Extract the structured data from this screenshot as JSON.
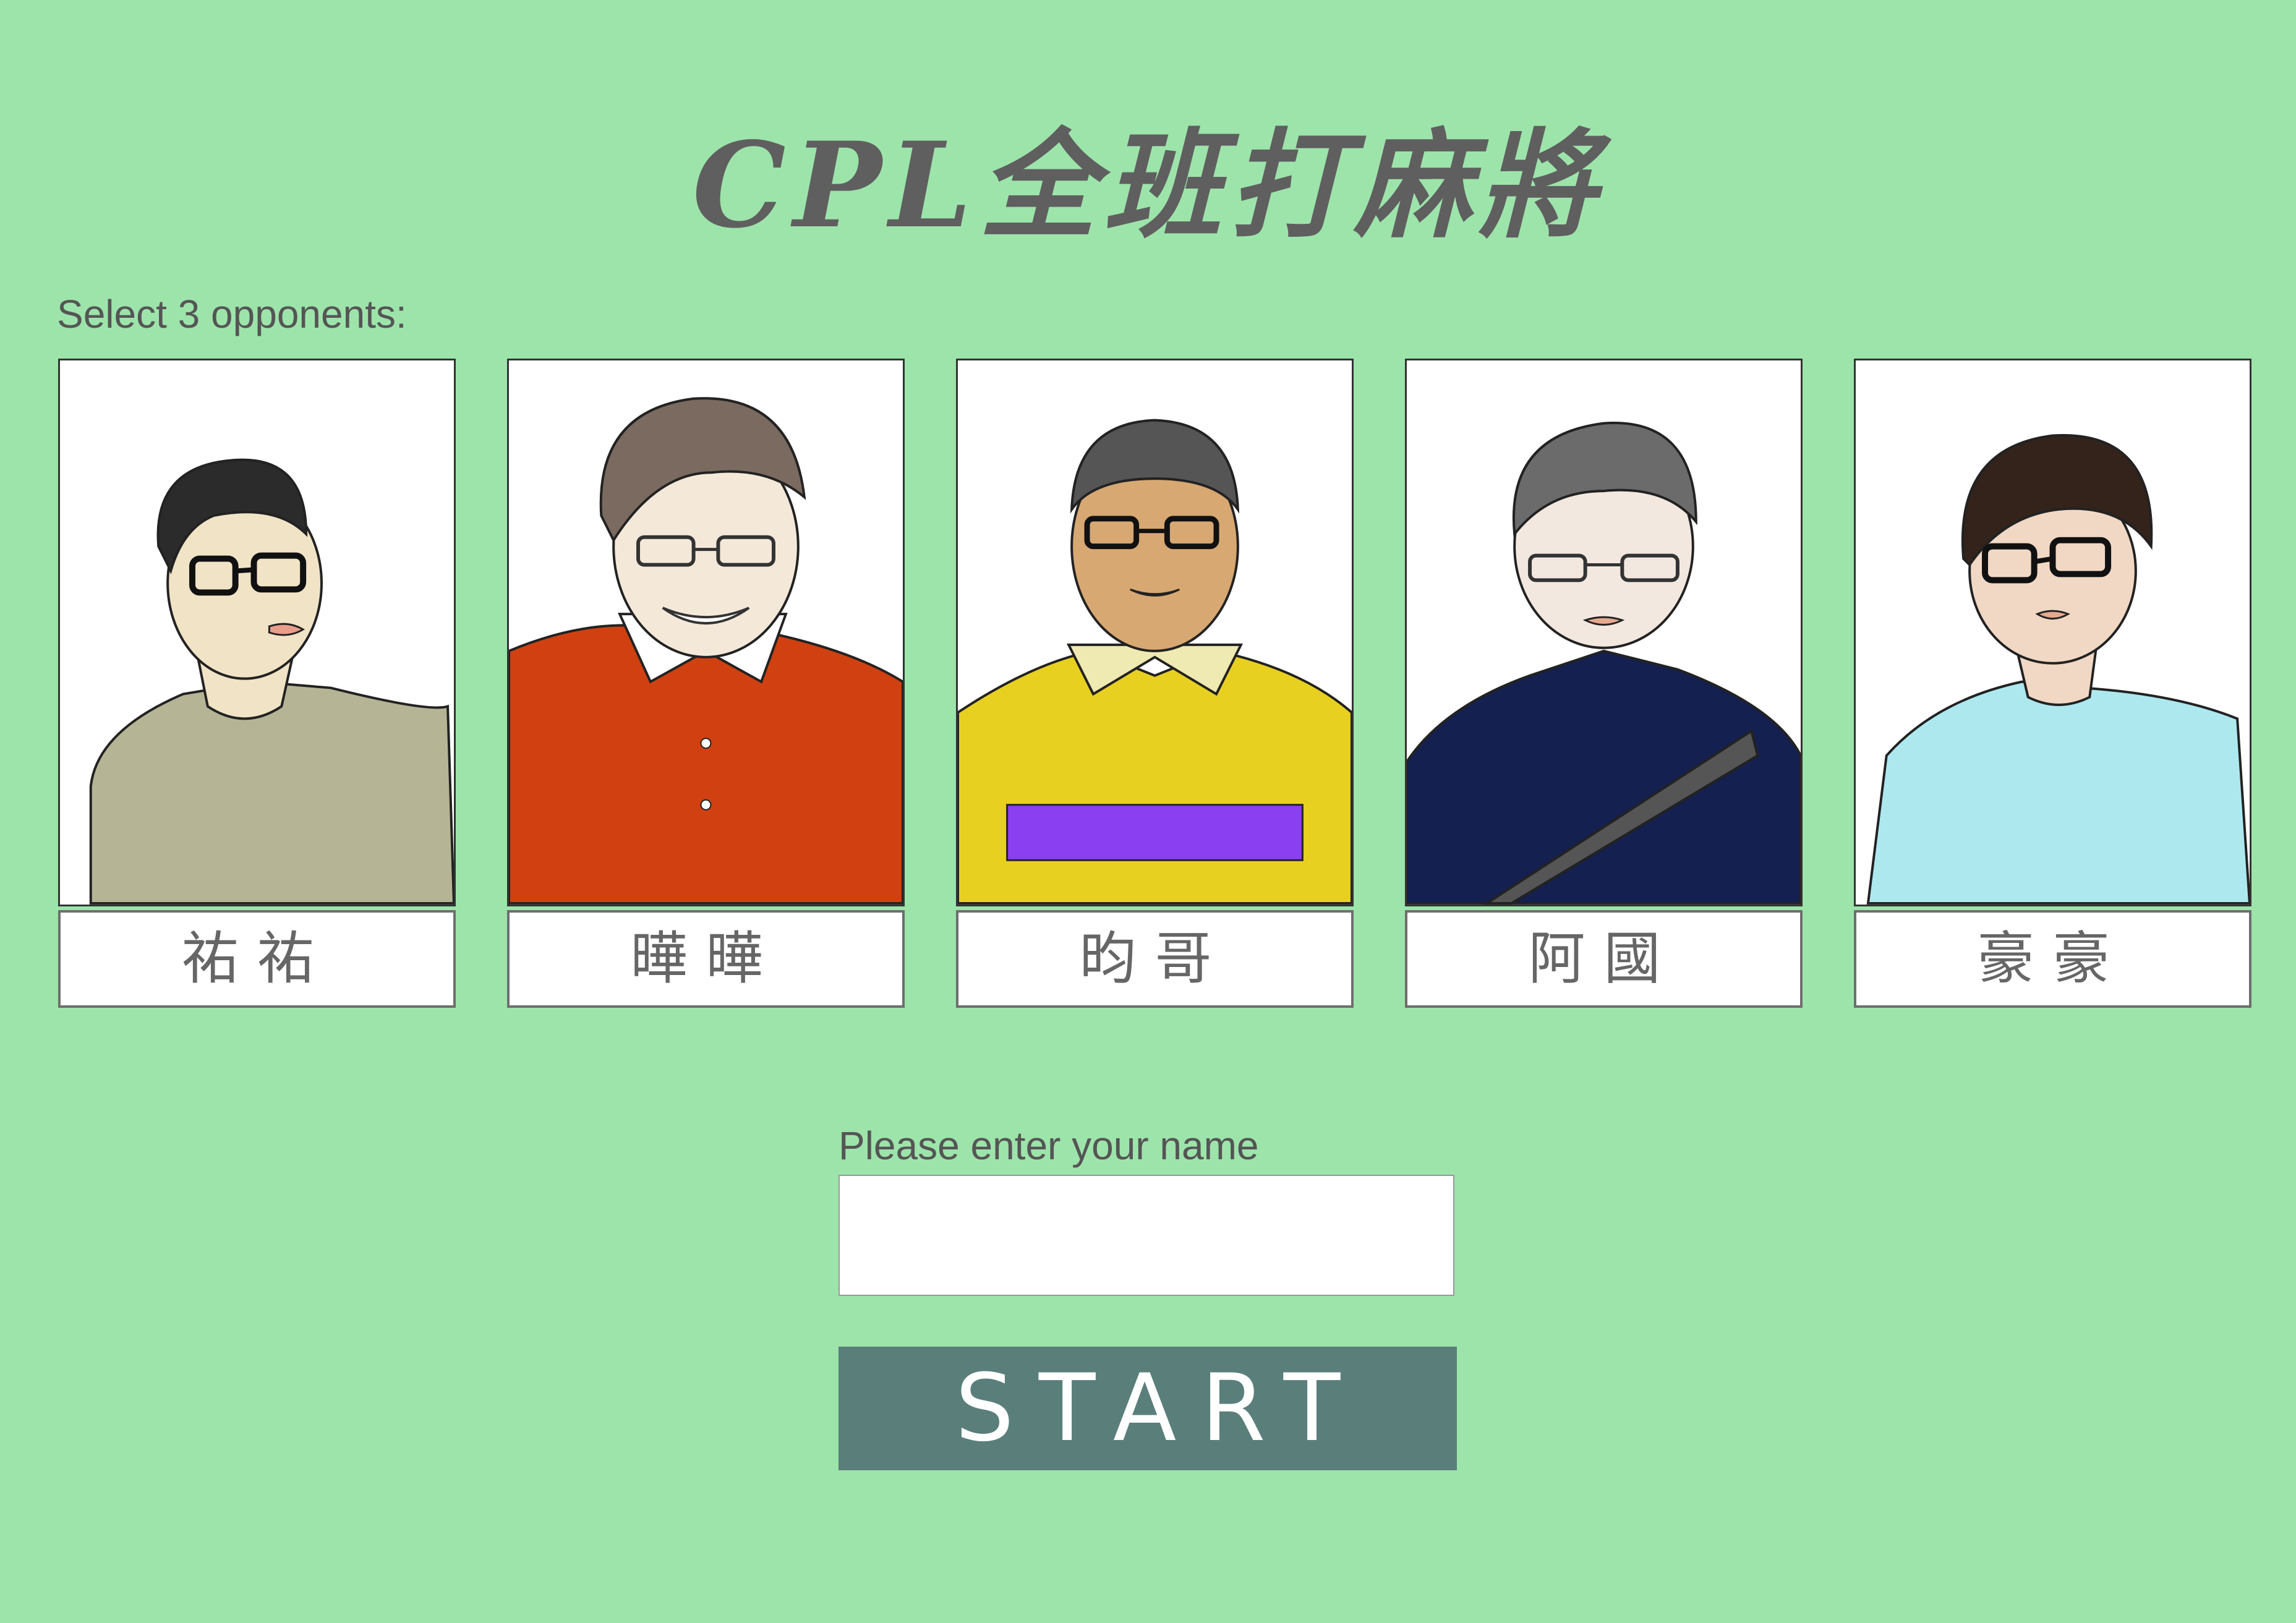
{
  "title": "CPL全班打麻將",
  "select_label": "Select 3 opponents:",
  "opponents": [
    {
      "name": "祐祐",
      "shirt_color": "#b5b596",
      "skin_color": "#f1e3c6",
      "hair_color": "#2b2b2b"
    },
    {
      "name": "曄曄",
      "shirt_color": "#d04010",
      "skin_color": "#f4e8d9",
      "hair_color": "#7a6a5f"
    },
    {
      "name": "昀哥",
      "shirt_color": "#e8d020",
      "skin_color": "#d7a872",
      "hair_color": "#555555"
    },
    {
      "name": "阿國",
      "shirt_color": "#142050",
      "skin_color": "#f2e8df",
      "hair_color": "#6b6b6b"
    },
    {
      "name": "豪豪",
      "shirt_color": "#ade8ef",
      "skin_color": "#f1d8c4",
      "hair_color": "#33231b"
    }
  ],
  "name_prompt": "Please enter your name",
  "name_input_value": "",
  "start_label": "START",
  "colors": {
    "background": "#9de4ab",
    "button": "#5a7f7b",
    "text": "#5a5a5a"
  }
}
